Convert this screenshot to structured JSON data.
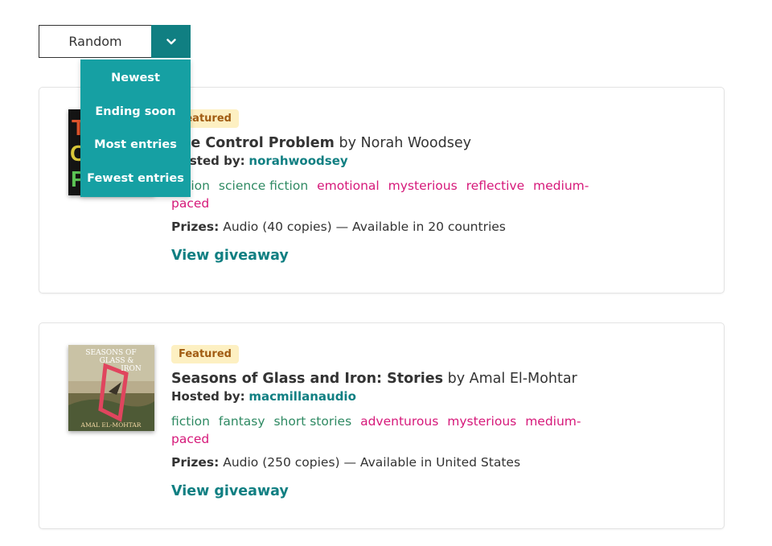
{
  "sort": {
    "selected": "Random",
    "options": [
      "Newest",
      "Ending soon",
      "Most entries",
      "Fewest entries"
    ],
    "toggle_icon": "chevron-down-icon"
  },
  "giveaways": [
    {
      "badge": "Featured",
      "title": "The Control Problem",
      "by": "by",
      "author": "Norah Woodsey",
      "hosted_label": "Hosted by:",
      "host": "norahwoodsey",
      "genres": [
        "fiction",
        "science fiction"
      ],
      "moods": [
        "emotional",
        "mysterious",
        "reflective",
        "medium-paced"
      ],
      "prizes_label": "Prizes:",
      "prizes": "Audio (40 copies) — Available in 20 countries",
      "link": "View giveaway",
      "cover_text": [
        "T",
        "C",
        "P"
      ]
    },
    {
      "badge": "Featured",
      "title": "Seasons of Glass and Iron: Stories",
      "by": "by",
      "author": "Amal El-Mohtar",
      "hosted_label": "Hosted by:",
      "host": "macmillanaudio",
      "genres": [
        "fiction",
        "fantasy",
        "short stories"
      ],
      "moods": [
        "adventurous",
        "mysterious",
        "medium-paced"
      ],
      "prizes_label": "Prizes:",
      "prizes": "Audio (250 copies) — Available in United States",
      "link": "View giveaway",
      "cover_text": [
        "SEASONS OF",
        "GLASS &",
        "IRON",
        "AMAL EL-MOHTAR"
      ]
    }
  ],
  "colors": {
    "accent": "#107f82",
    "menu_bg": "#16a0a3",
    "genre_tag": "#2f8a63",
    "mood_tag": "#d6197a",
    "badge_bg": "#fdf0c2",
    "badge_text": "#a15c12"
  }
}
